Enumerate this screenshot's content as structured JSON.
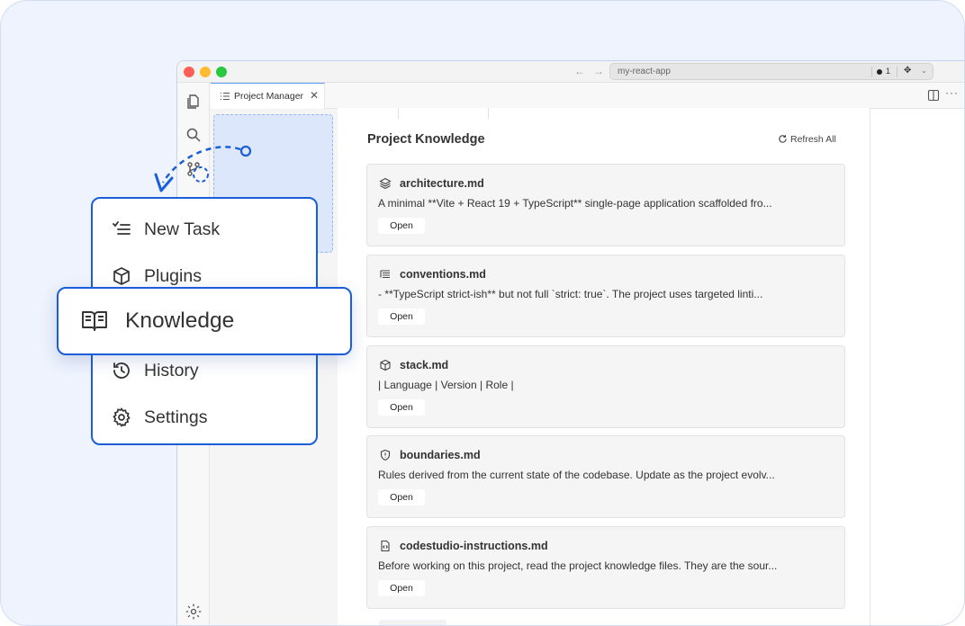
{
  "window": {
    "address": "my-react-app",
    "status_count": "1",
    "nav_back_icon": "arrow-left-icon",
    "nav_forward_icon": "arrow-right-icon"
  },
  "tab": {
    "label": "Project Manager",
    "close_glyph": "✕",
    "more_glyph": "···"
  },
  "main": {
    "title": "Project Knowledge",
    "refresh_label": "Refresh All"
  },
  "cards": [
    {
      "icon": "layers-icon",
      "name": "architecture.md",
      "desc": "A minimal **Vite + React 19 + TypeScript** single-page application scaffolded fro...",
      "open": "Open"
    },
    {
      "icon": "text-align-icon",
      "name": "conventions.md",
      "desc": "- **TypeScript strict-ish** but not full `strict: true`. The project uses targeted linti...",
      "open": "Open"
    },
    {
      "icon": "box-icon",
      "name": "stack.md",
      "desc": "| Language | Version | Role |",
      "open": "Open"
    },
    {
      "icon": "shield-icon",
      "name": "boundaries.md",
      "desc": "Rules derived from the current state of the codebase. Update as the project evolv...",
      "open": "Open"
    },
    {
      "icon": "code-file-icon",
      "name": "codestudio-instructions.md",
      "desc": "Before working on this project, read the project knowledge files. They are the sour...",
      "open": "Open"
    }
  ],
  "menu": {
    "items": [
      {
        "label": "New Task",
        "icon": "list-check-icon"
      },
      {
        "label": "Plugins",
        "icon": "package-icon"
      },
      {
        "label": "History",
        "icon": "history-icon"
      },
      {
        "label": "Settings",
        "icon": "gear-icon"
      }
    ],
    "highlighted": {
      "label": "Knowledge",
      "icon": "book-open-icon"
    }
  },
  "colors": {
    "accent": "#1a5fd9",
    "background": "#eef3fd"
  }
}
